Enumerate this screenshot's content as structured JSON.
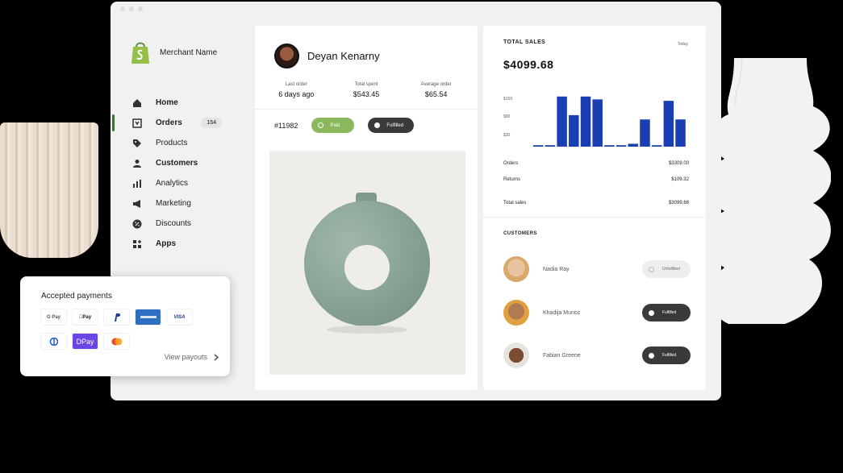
{
  "colors": {
    "accent": "#2e7d32",
    "bar": "#1a3fb5",
    "paid": "#8bb85c",
    "dark_pill": "#3a3a3a"
  },
  "sidebar": {
    "merchant_name": "Merchant Name",
    "items": [
      {
        "label": "Home",
        "icon": "home-icon"
      },
      {
        "label": "Orders",
        "icon": "orders-icon",
        "badge": "154"
      },
      {
        "label": "Products",
        "icon": "tag-icon"
      },
      {
        "label": "Customers",
        "icon": "person-icon"
      },
      {
        "label": "Analytics",
        "icon": "bar-chart-icon"
      },
      {
        "label": "Marketing",
        "icon": "megaphone-icon"
      },
      {
        "label": "Discounts",
        "icon": "discount-icon"
      },
      {
        "label": "Apps",
        "icon": "apps-icon"
      }
    ]
  },
  "customer": {
    "name": "Deyan Kenarny",
    "stats": [
      {
        "label": "Last order",
        "value": "6 days ago"
      },
      {
        "label": "Total spent",
        "value": "$543.45"
      },
      {
        "label": "Average order",
        "value": "$65.54"
      }
    ],
    "order_id": "#11982",
    "paid_label": "Paid",
    "fulfilled_label": "Fulfilled"
  },
  "sales": {
    "title": "TOTAL SALES",
    "period": "Today",
    "amount": "$4099.68",
    "orders_label": "Orders",
    "orders_value": "$3309.00",
    "returns_label": "Returns",
    "returns_value": "$109.32",
    "total_label": "Total sales",
    "total_value": "$3099.68"
  },
  "chart_data": {
    "type": "bar",
    "y_ticks": [
      "$150",
      "$90",
      "$30"
    ],
    "values": [
      5,
      5,
      175,
      110,
      175,
      165,
      5,
      5,
      10,
      95,
      5,
      160,
      95
    ],
    "ylim": [
      0,
      180
    ]
  },
  "customers": {
    "title": "CUSTOMERS",
    "rows": [
      {
        "name": "Nadia Ray",
        "status": "Unfulfilled"
      },
      {
        "name": "Khadija Munoz",
        "status": "Fulfilled"
      },
      {
        "name": "Fabian Greene",
        "status": "Fulfilled"
      }
    ]
  },
  "payments": {
    "title": "Accepted payments",
    "methods": [
      "G Pay",
      "Apple Pay",
      "PayPal",
      "Amex",
      "VISA",
      "Diners",
      "DPay",
      "Mastercard"
    ],
    "visible_text": {
      "gpay": "G Pay",
      "applepay": "Pay",
      "visa": "VISA",
      "dpay": "DPay"
    },
    "view_payouts": "View payouts"
  }
}
